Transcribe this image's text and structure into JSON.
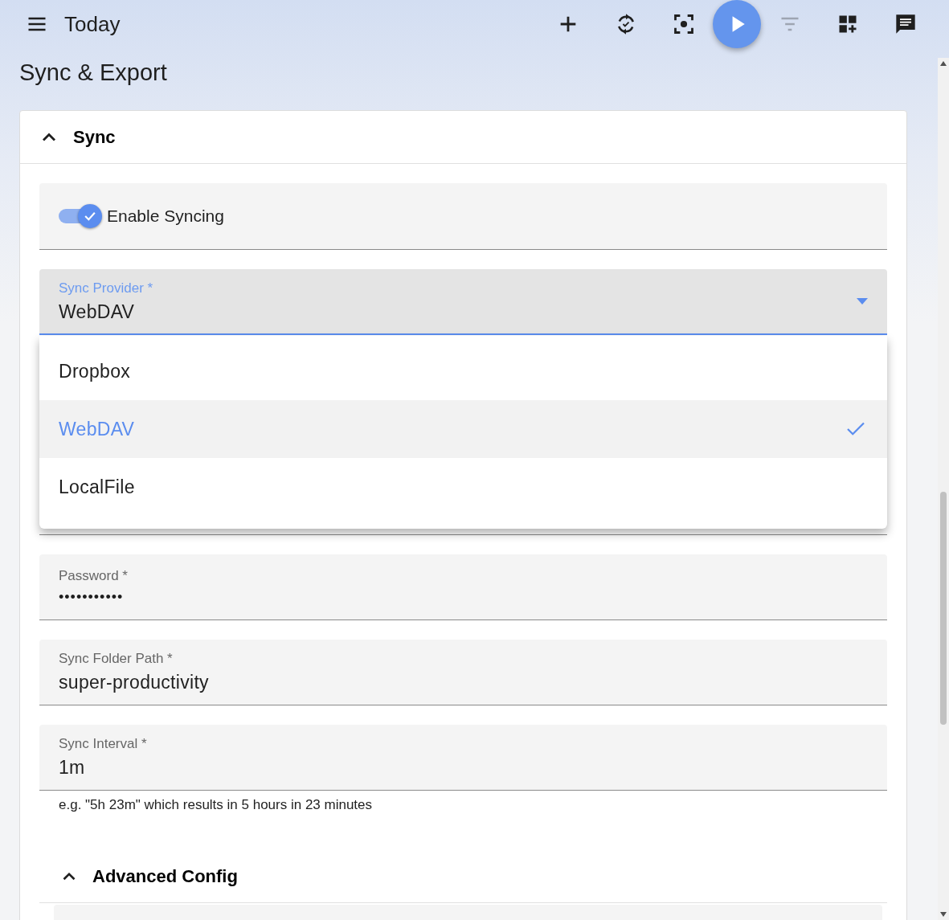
{
  "app_bar": {
    "title": "Today",
    "actions": [
      {
        "kind": "add",
        "disabled": false
      },
      {
        "kind": "sync",
        "disabled": false
      },
      {
        "kind": "focus",
        "disabled": false
      },
      {
        "kind": "play",
        "disabled": false
      },
      {
        "kind": "filter",
        "disabled": true
      },
      {
        "kind": "add-widget",
        "disabled": false
      },
      {
        "kind": "chat",
        "disabled": false
      }
    ]
  },
  "page_title": "Sync & Export",
  "sync_panel": {
    "title": "Sync",
    "expanded": true
  },
  "enable_syncing": {
    "label": "Enable Syncing",
    "on": true
  },
  "sync_provider": {
    "label": "Sync Provider *",
    "value": "WebDAV"
  },
  "provider_menu": {
    "options": [
      {
        "label": "Dropbox",
        "selected": false
      },
      {
        "label": "WebDAV",
        "selected": true
      },
      {
        "label": "LocalFile",
        "selected": false
      }
    ]
  },
  "fields": [
    {
      "kind": "password",
      "label": "Password *",
      "value": "•••••••••••"
    },
    {
      "kind": "text",
      "label": "Sync Folder Path *",
      "value": "super-productivity"
    },
    {
      "kind": "text",
      "label": "Sync Interval *",
      "value": "1m",
      "hint": "e.g. \"5h 23m\" which results in 5 hours in 23 minutes"
    }
  ],
  "advanced_config": {
    "title": "Advanced Config",
    "expanded": true
  }
}
